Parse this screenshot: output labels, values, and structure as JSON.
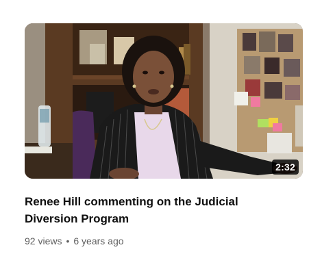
{
  "video": {
    "duration": "2:32",
    "title_line1": "Renee Hill commenting on the Judicial",
    "title_line2": "Diversion Program",
    "views": "92 views",
    "separator": "•",
    "age": "6 years ago"
  },
  "colors": {
    "title_text": "#0f0f0f",
    "meta_text": "#606060",
    "duration_bg": "#000000",
    "duration_text": "#ffffff"
  }
}
